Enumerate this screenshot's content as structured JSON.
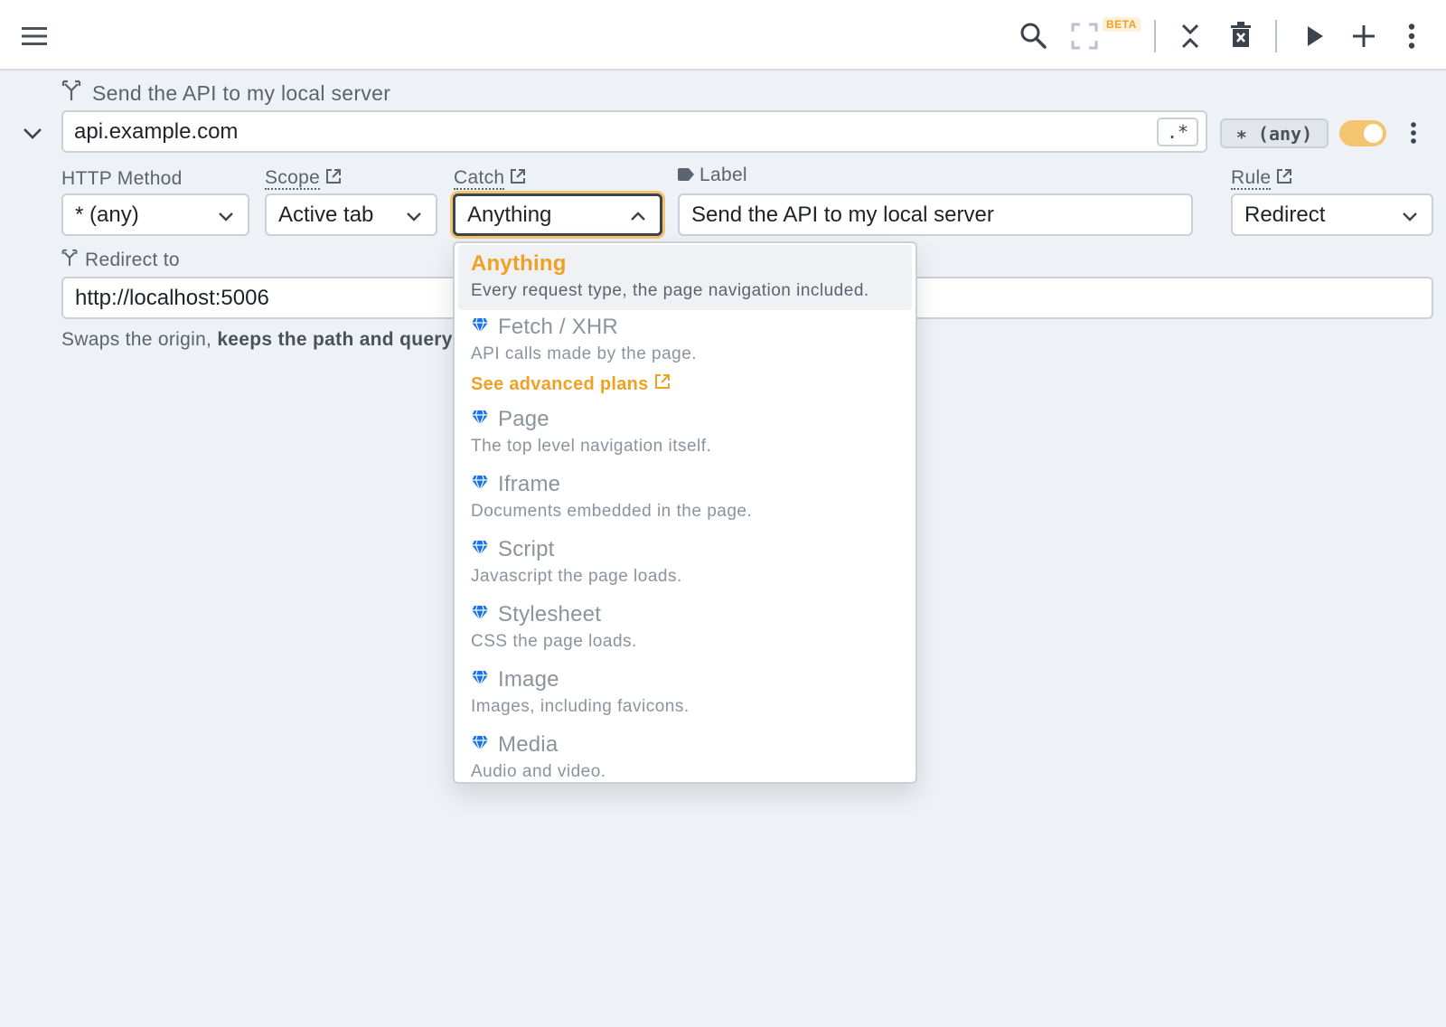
{
  "toolbar": {
    "beta_label": "BETA",
    "icons": [
      "menu-icon",
      "search-icon",
      "fullscreen-icon",
      "collapse-all-icon",
      "delete-all-icon",
      "play-icon",
      "add-icon",
      "more-vert-icon"
    ]
  },
  "rule": {
    "title": "Send the API to my local server",
    "url_pattern": "api.example.com",
    "regex_label": ".*",
    "method_badge": "∗ (any)",
    "enabled": true
  },
  "fields": {
    "http_method": {
      "label": "HTTP Method",
      "value": "* (any)"
    },
    "scope": {
      "label": "Scope",
      "value": "Active tab"
    },
    "catch": {
      "label": "Catch",
      "value": "Anything"
    },
    "label": {
      "label": "Label",
      "value": "Send the API to my local server"
    },
    "rule": {
      "label": "Rule",
      "value": "Redirect"
    }
  },
  "redirect": {
    "label": "Redirect to",
    "value": "http://localhost:5006",
    "hint_prefix": "Swaps the origin, ",
    "hint_bold": "keeps the path and query"
  },
  "catch_dropdown": {
    "options": [
      {
        "title": "Anything",
        "desc": "Every request type, the page navigation included.",
        "premium": false,
        "selected": true
      },
      {
        "title": "Fetch / XHR",
        "desc": "API calls made by the page.",
        "premium": true,
        "selected": false
      },
      {
        "title": "Page",
        "desc": "The top level navigation itself.",
        "premium": true,
        "selected": false
      },
      {
        "title": "Iframe",
        "desc": "Documents embedded in the page.",
        "premium": true,
        "selected": false
      },
      {
        "title": "Script",
        "desc": "Javascript the page loads.",
        "premium": true,
        "selected": false
      },
      {
        "title": "Stylesheet",
        "desc": "CSS the page loads.",
        "premium": true,
        "selected": false
      },
      {
        "title": "Image",
        "desc": "Images, including favicons.",
        "premium": true,
        "selected": false
      },
      {
        "title": "Media",
        "desc": "Audio and video.",
        "premium": true,
        "selected": false
      }
    ],
    "see_plans_label": "See advanced plans"
  },
  "colors": {
    "accent": "#f0a022",
    "premium_icon": "#1a73e8",
    "toggle_on": "#f5c46f"
  }
}
